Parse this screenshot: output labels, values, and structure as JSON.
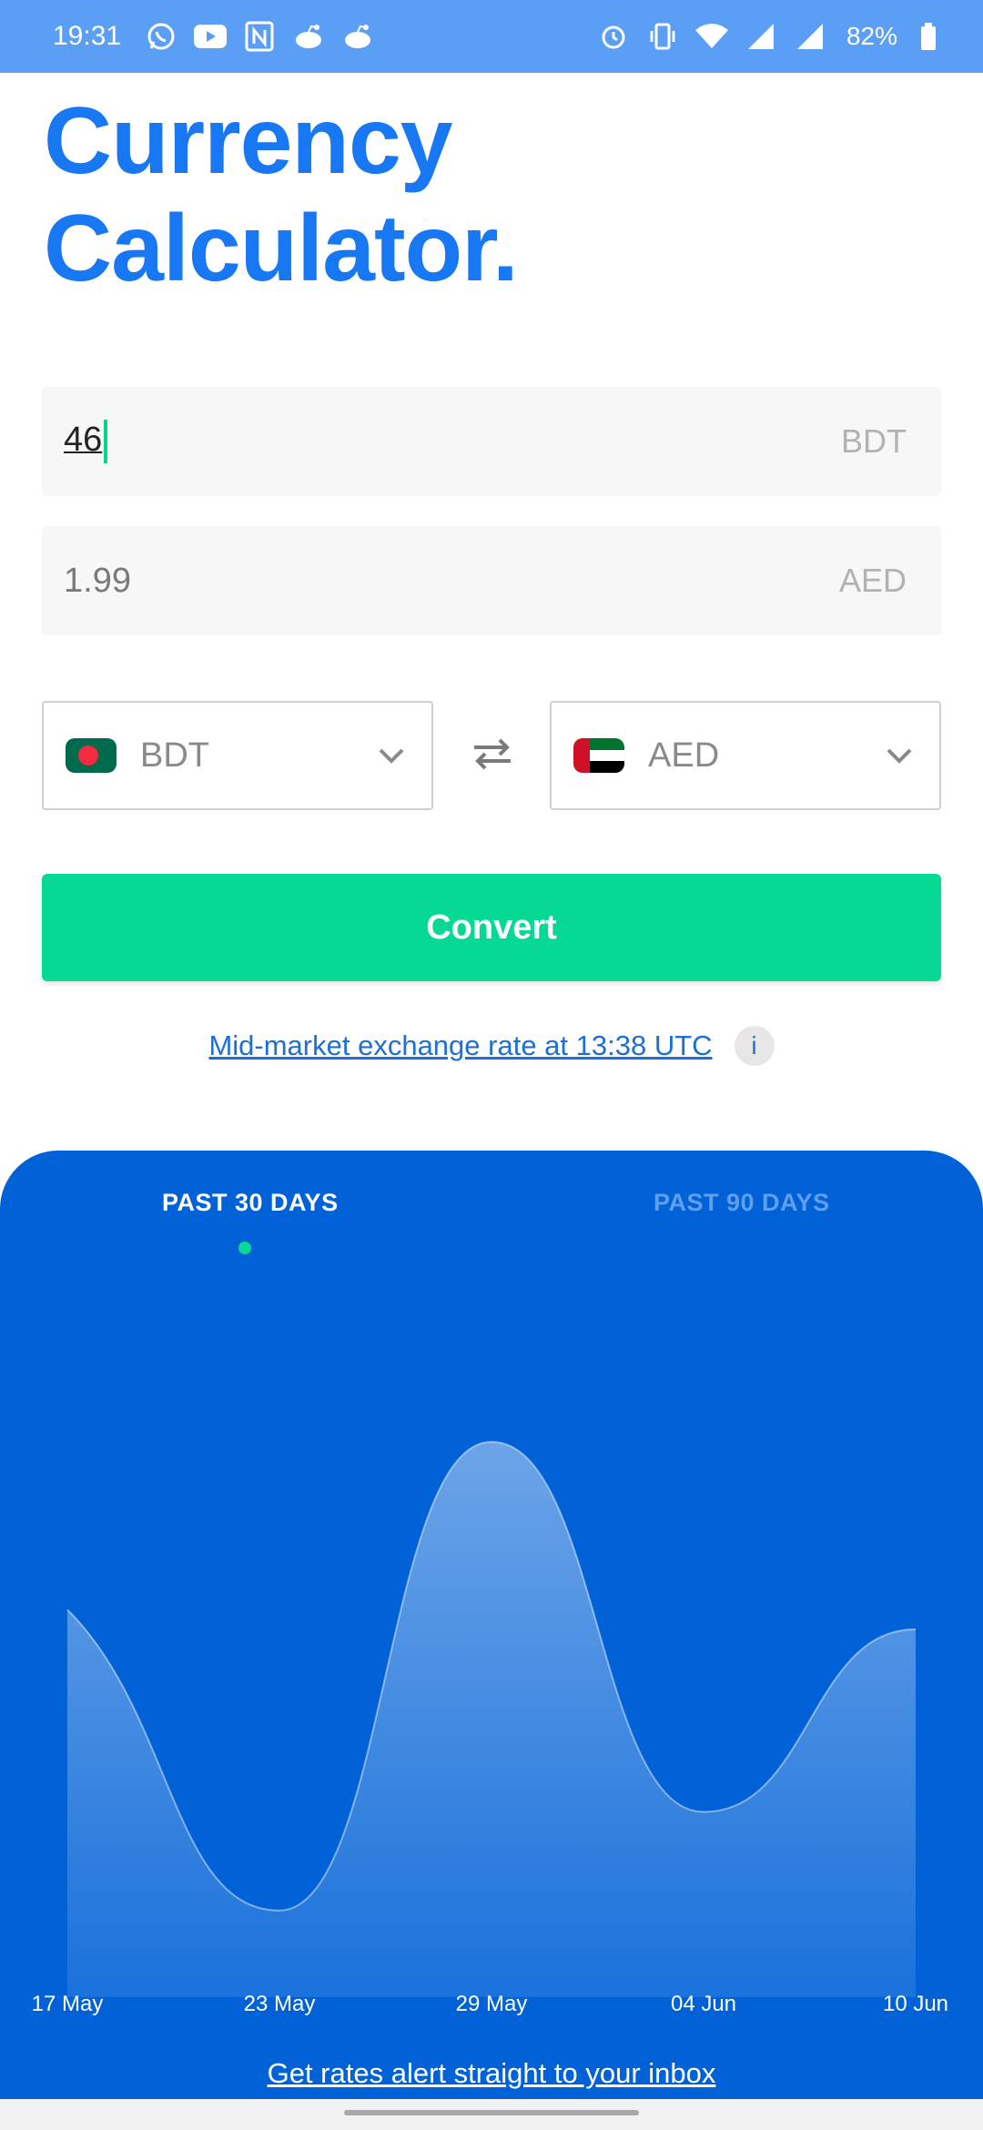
{
  "status_bar": {
    "time": "19:31",
    "notification_icons": [
      "whatsapp-icon",
      "youtube-icon",
      "notion-icon",
      "reddit-icon",
      "reddit-icon"
    ],
    "system_icons": [
      "alarm-icon",
      "vibrate-icon",
      "wifi-icon",
      "signal-icon",
      "signal-icon"
    ],
    "battery": "82%"
  },
  "header": {
    "title_line1": "Currency",
    "title_line2": "Calculator."
  },
  "converter": {
    "amount_value": "46",
    "amount_currency": "BDT",
    "result_value": "1.99",
    "result_currency": "AED",
    "from_currency": "BDT",
    "to_currency": "AED",
    "convert_label": "Convert",
    "rate_text": "Mid-market exchange rate at 13:38 UTC",
    "info_label": "i"
  },
  "chart_panel": {
    "tabs": [
      {
        "label": "PAST 30 DAYS",
        "active": true
      },
      {
        "label": "PAST 90 DAYS",
        "active": false
      }
    ],
    "alert_link": "Get rates alert straight to your inbox"
  },
  "chart_data": {
    "type": "area",
    "x_tick_labels": [
      "17 May",
      "23 May",
      "29 May",
      "04 Jun",
      "10 Jun"
    ],
    "series": [
      {
        "values": [
          0.66,
          0.05,
          1.0,
          0.25,
          0.62
        ]
      }
    ],
    "y_axis": "not shown",
    "grid": false
  },
  "colors": {
    "title_blue": "#1877f2",
    "panel_blue": "#0162d7",
    "accent_green": "#06d993",
    "status_bar": "#5b9ef6"
  }
}
